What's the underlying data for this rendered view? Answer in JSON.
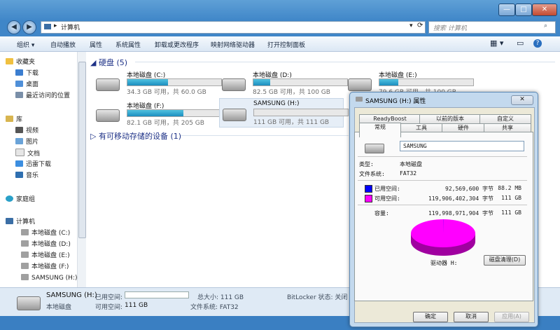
{
  "window": {
    "address": "计算机",
    "search_placeholder": "搜索 计算机",
    "caption_min": "—",
    "caption_max": "□",
    "caption_close": "✕"
  },
  "toolbar": {
    "items": [
      "组织 ▾",
      "自动播放",
      "属性",
      "系统属性",
      "卸载或更改程序",
      "映射网络驱动器",
      "打开控制面板"
    ]
  },
  "sidebar": {
    "favorites": "收藏夹",
    "fav_items": [
      "下载",
      "桌面",
      "最近访问的位置"
    ],
    "libraries": "库",
    "lib_items": [
      "视频",
      "图片",
      "文档",
      "迅雷下载",
      "音乐"
    ],
    "homegroup": "家庭组",
    "computer": "计算机",
    "computer_items": [
      "本地磁盘 (C:)",
      "本地磁盘 (D:)",
      "本地磁盘 (E:)",
      "本地磁盘 (F:)",
      "SAMSUNG (H:)"
    ]
  },
  "content": {
    "hdd_group": "硬盘 (5)",
    "removable_group": "有可移动存储的设备 (1)",
    "drives": [
      {
        "name": "本地磁盘 (C:)",
        "info": "34.3 GB 可用，共 60.0 GB",
        "used_fraction": 0.43
      },
      {
        "name": "本地磁盘 (D:)",
        "info": "82.5 GB 可用，共 100 GB",
        "used_fraction": 0.18
      },
      {
        "name": "本地磁盘 (E:)",
        "info": "79.6 GB 可用，共 100 GB",
        "used_fraction": 0.2
      },
      {
        "name": "本地磁盘 (F:)",
        "info": "82.1 GB 可用，共 205 GB",
        "used_fraction": 0.6
      },
      {
        "name": "SAMSUNG (H:)",
        "info": "111 GB 可用，共 111 GB",
        "used_fraction": 0.0
      }
    ]
  },
  "details": {
    "name": "SAMSUNG (H:)",
    "type": "本地磁盘",
    "used_label": "已用空间:",
    "free_label": "可用空间:",
    "free_value": "111 GB",
    "total": "总大小: 111 GB",
    "fs": "文件系统: FAT32",
    "bitlocker": "BitLocker 状态: 关闭"
  },
  "dialog": {
    "title": "SAMSUNG (H:) 属性",
    "close": "✕",
    "tabs_row1": [
      "ReadyBoost",
      "以前的版本",
      "自定义"
    ],
    "tabs_row2": [
      "常规",
      "工具",
      "硬件",
      "共享"
    ],
    "volume_label": "SAMSUNG",
    "type_label": "类型:",
    "type_value": "本地磁盘",
    "fs_label": "文件系统:",
    "fs_value": "FAT32",
    "used_label": "已用空间:",
    "used_bytes": "92,569,600 字节",
    "used_size": "88.2 MB",
    "free_label": "可用空间:",
    "free_bytes": "119,906,402,304 字节",
    "free_size": "111 GB",
    "cap_label": "容量:",
    "cap_bytes": "119,998,971,904 字节",
    "cap_size": "111 GB",
    "drive_label": "驱动器 H:",
    "cleanup": "磁盘清理(D)",
    "ok": "确定",
    "cancel": "取消",
    "apply": "应用(A)",
    "used_color": "#0000ff",
    "free_color": "#ff00ff"
  }
}
